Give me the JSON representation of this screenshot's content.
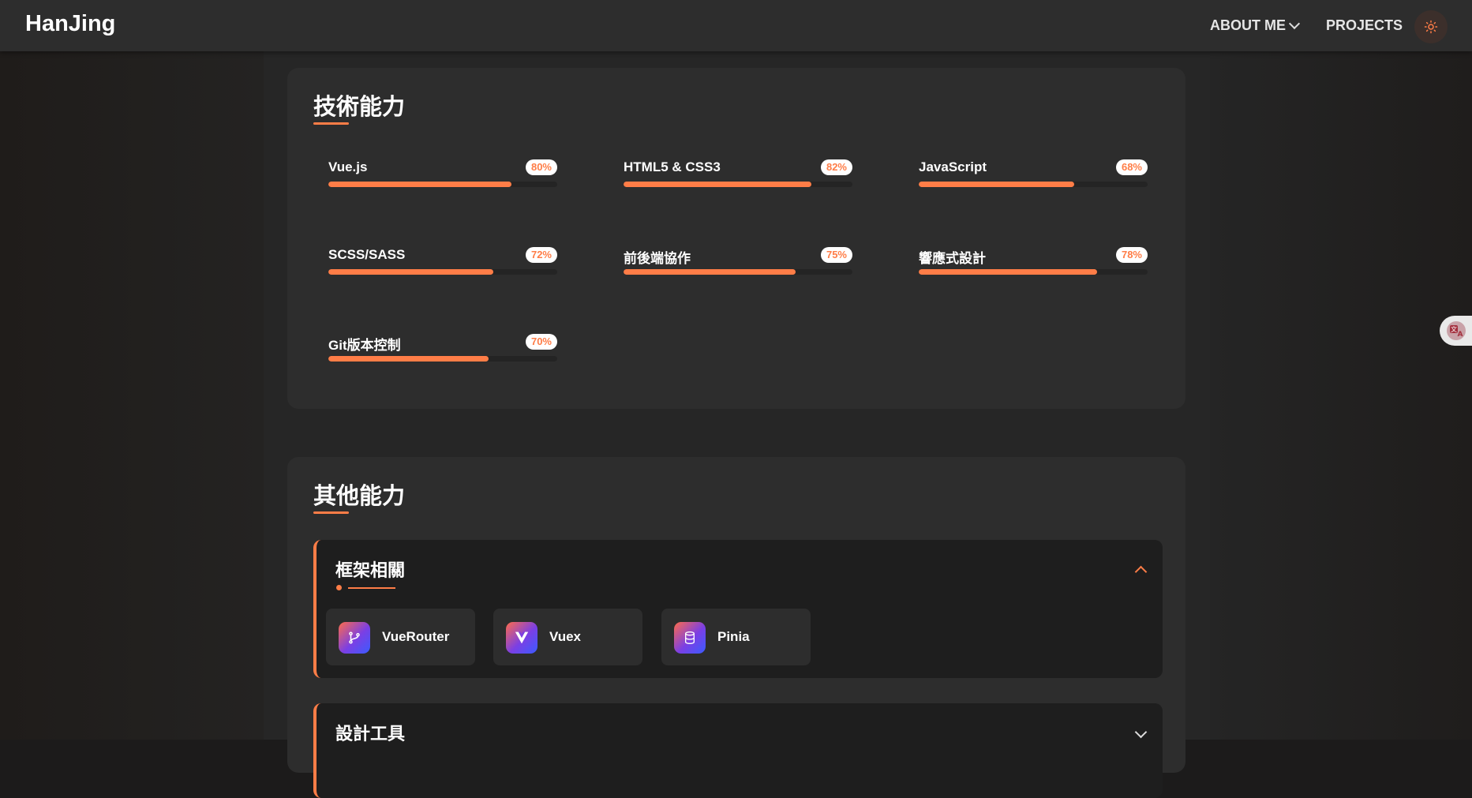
{
  "brand": {
    "logo": "HanJing"
  },
  "nav": {
    "about_label": "ABOUT ME",
    "projects_label": "PROJECTS",
    "theme_icon": "sun-icon"
  },
  "colors": {
    "accent": "#ff7d47",
    "card": "#2d2d2d",
    "background": "#1c1b1b"
  },
  "tech": {
    "title": "技術能力",
    "skills": [
      {
        "name": "Vue.js",
        "percent_label": "80%",
        "value": 80
      },
      {
        "name": "HTML5 & CSS3",
        "percent_label": "82%",
        "value": 82
      },
      {
        "name": "JavaScript",
        "percent_label": "68%",
        "value": 68
      },
      {
        "name": "SCSS/SASS",
        "percent_label": "72%",
        "value": 72
      },
      {
        "name": "前後端協作",
        "percent_label": "75%",
        "value": 75
      },
      {
        "name": "響應式設計",
        "percent_label": "78%",
        "value": 78
      },
      {
        "name": "Git版本控制",
        "percent_label": "70%",
        "value": 70
      }
    ]
  },
  "other": {
    "title": "其他能力",
    "categories": [
      {
        "title": "框架相關",
        "expanded": true,
        "items": [
          {
            "label": "VueRouter",
            "icon": "git-branch-icon"
          },
          {
            "label": "Vuex",
            "icon": "vue-logo-icon"
          },
          {
            "label": "Pinia",
            "icon": "database-icon"
          }
        ]
      },
      {
        "title": "設計工具",
        "expanded": false,
        "items": []
      }
    ]
  },
  "widgets": {
    "translate_icon": "translate-icon"
  }
}
